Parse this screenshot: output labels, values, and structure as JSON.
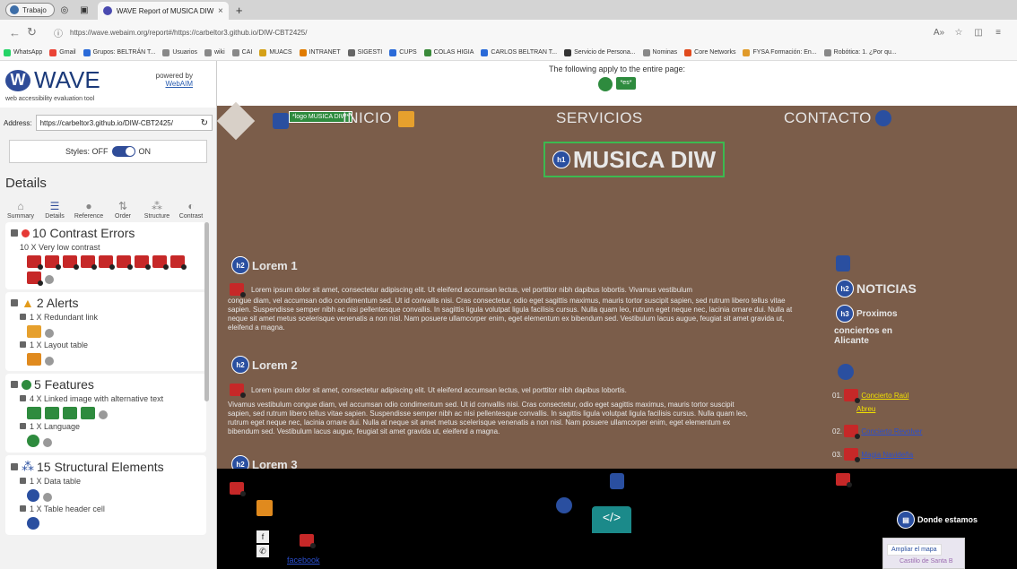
{
  "browser": {
    "profile_label": "Trabajo",
    "tab_title": "WAVE Report of MUSICA DIW",
    "tab_close": "×",
    "new_tab": "+",
    "url": "https://wave.webaim.org/report#/https://carbeltor3.github.io/DIW-CBT2425/",
    "bookmarks": [
      "WhatsApp",
      "Gmail",
      "Grupos: BELTRÁN T...",
      "Usuarios",
      "wiki",
      "CAI",
      "MUACS",
      "INTRANET",
      "SIGESTI",
      "CUPS",
      "COLAS HIGIA",
      "CARLOS BELTRAN T...",
      "Servicio de Persona...",
      "Nominas",
      "Core Networks",
      "FYSA Formación: En...",
      "Robótica: 1. ¿Por qu..."
    ]
  },
  "wave": {
    "logo": "WAVE",
    "subtitle": "web accessibility evaluation tool",
    "powered_by": "powered by",
    "webaim": "WebAIM",
    "address_label": "Address:",
    "address_value": "https://carbeltor3.github.io/DIW-CBT2425/",
    "styles_label": "Styles:",
    "styles_off": "OFF",
    "styles_on": "ON",
    "details_title": "Details",
    "tabs": [
      "Summary",
      "Details",
      "Reference",
      "Order",
      "Structure",
      "Contrast"
    ],
    "contrast": {
      "title": "10 Contrast Errors",
      "item": "10 X Very low contrast"
    },
    "alerts": {
      "title": "2 Alerts",
      "item1": "1 X Redundant link",
      "item2": "1 X Layout table"
    },
    "features": {
      "title": "5 Features",
      "item1": "4 X Linked image with alternative text",
      "item2": "1 X Language"
    },
    "structural": {
      "title": "15 Structural Elements",
      "item1": "1 X Data table",
      "item2": "1 X Table header cell"
    }
  },
  "page": {
    "apply_text": "The following apply to the entire page:",
    "lang_badge": "*es*",
    "nav_inicio": "INICIO",
    "nav_servicios": "SERVICIOS",
    "nav_contacto": "CONTACTO",
    "logo_alt": "*logo MUSICA DIW*",
    "main_title": "MUSICA DIW",
    "h1": "h1",
    "h2": "h2",
    "h3": "h3",
    "section1": "Lorem 1",
    "section2": "Lorem 2",
    "section3": "Lorem 3",
    "para1_first": "Lorem ipsum dolor sit amet, consectetur adipiscing elit. Ut eleifend accumsan lectus, vel porttitor nibh dapibus lobortis. Vivamus vestibulum",
    "para1_rest": "congue diam, vel accumsan odio condimentum sed. Ut id convallis nisi. Cras consectetur, odio eget sagittis maximus, mauris tortor suscipit sapien, sed rutrum libero tellus vitae sapien. Suspendisse semper nibh ac nisi pellentesque convallis. In sagittis ligula volutpat ligula facilisis cursus. Nulla quam leo, rutrum eget neque nec, lacinia ornare dui. Nulla at neque sit amet metus scelerisque venenatis a non nisl. Nam posuere ullamcorper enim, eget elementum ex bibendum sed. Vestibulum lacus augue, feugiat sit amet gravida ut, eleifend a magna.",
    "para2_first": "Lorem ipsum dolor sit amet, consectetur adipiscing elit. Ut eleifend accumsan lectus, vel porttitor nibh dapibus lobortis.",
    "para2_rest": "Vivamus vestibulum congue diam, vel accumsan odio condimentum sed. Ut id convallis nisi. Cras consectetur, odio eget sagittis maximus, mauris tortor suscipit sapien, sed rutrum libero tellus vitae sapien. Suspendisse semper nibh ac nisi pellentesque convallis. In sagittis ligula volutpat ligula facilisis cursus. Nulla quam leo, rutrum eget neque nec, lacinia ornare dui. Nulla at neque sit amet metus scelerisque venenatis a non nisl. Nam posuere ullamcorper enim, eget elementum ex bibendum sed. Vestibulum lacus augue, feugiat sit amet gravida ut, eleifend a magna.",
    "noticias": "NOTICIAS",
    "proximos": "Proximos",
    "proximos_rest": "conciertos en Alicante",
    "news": [
      {
        "num": "01.",
        "label": "Concierto Raúl",
        "label2": "Abreu"
      },
      {
        "num": "02.",
        "label": "Concierto Revolver"
      },
      {
        "num": "03.",
        "label": "Magia Navideña"
      }
    ],
    "donde": "Donde estamos",
    "map_button": "Ampliar el mapa",
    "map_place": "Castillo de Santa B",
    "facebook": "facebook",
    "code_label": "</>"
  }
}
